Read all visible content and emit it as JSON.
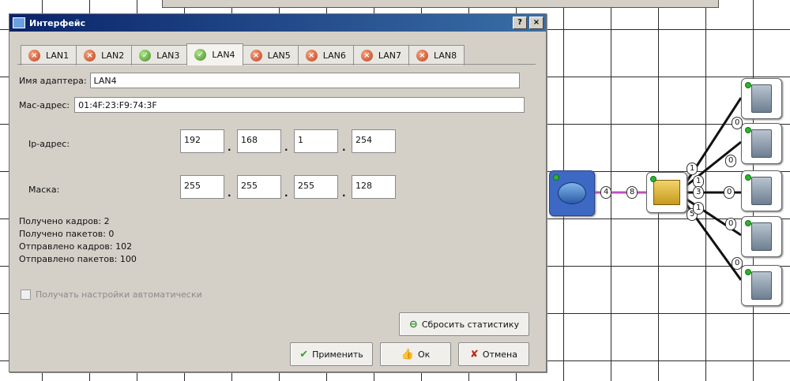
{
  "window": {
    "title": "Интерфейс",
    "help": "?",
    "close": "×"
  },
  "tabs": [
    {
      "label": "LAN1",
      "status": "off"
    },
    {
      "label": "LAN2",
      "status": "off"
    },
    {
      "label": "LAN3",
      "status": "on"
    },
    {
      "label": "LAN4",
      "status": "on",
      "active": true
    },
    {
      "label": "LAN5",
      "status": "off"
    },
    {
      "label": "LAN6",
      "status": "off"
    },
    {
      "label": "LAN7",
      "status": "off"
    },
    {
      "label": "LAN8",
      "status": "off"
    }
  ],
  "form": {
    "adapter_label": "Имя адаптера:",
    "adapter_value": "LAN4",
    "mac_label": "Мас-адрес:",
    "mac_value": "01:4F:23:F9:74:3F",
    "ip_label": "Ip-адрес:",
    "ip": [
      "192",
      "168",
      "1",
      "254"
    ],
    "mask_label": "Маска:",
    "mask": [
      "255",
      "255",
      "255",
      "128"
    ]
  },
  "stats": {
    "frames_received": "Получено кадров: 2",
    "packets_received": "Получено пакетов: 0",
    "frames_sent": "Отправлено кадров: 102",
    "packets_sent": "Отправлено пакетов: 100"
  },
  "auto_settings_label": "Получать настройки автоматически",
  "buttons": {
    "reset": "Сбросить статистику",
    "apply": "Применить",
    "ok": "Ок",
    "cancel": "Отмена"
  },
  "network": {
    "router_port": "4",
    "switch_in_port": "8",
    "switch_ports": [
      "1",
      "1",
      "3",
      "5",
      "1"
    ],
    "server_ports": [
      "0",
      "0",
      "0",
      "0",
      "0"
    ]
  },
  "colors": {
    "title_start": "#0a246a",
    "title_end": "#3a6ea5",
    "link": "#c050c0"
  }
}
